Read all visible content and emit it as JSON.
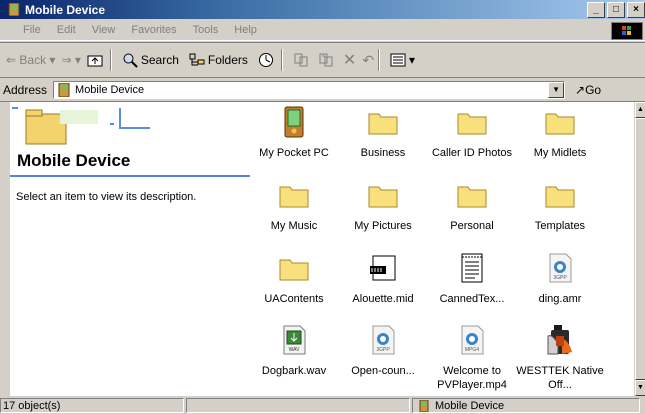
{
  "window": {
    "title": "Mobile Device",
    "icon": "mobile-device-icon"
  },
  "menu": [
    "File",
    "Edit",
    "View",
    "Favorites",
    "Tools",
    "Help"
  ],
  "toolbar": {
    "back": "Back",
    "search": "Search",
    "folders": "Folders"
  },
  "address": {
    "label": "Address",
    "value": "Mobile Device",
    "go": "Go"
  },
  "left_pane": {
    "title": "Mobile Device",
    "description": "Select an item to view its description."
  },
  "items": [
    {
      "label": "My Pocket PC",
      "icon": "pocket-pc-icon"
    },
    {
      "label": "Business",
      "icon": "folder-icon"
    },
    {
      "label": "Caller ID Photos",
      "icon": "folder-icon"
    },
    {
      "label": "My Midlets",
      "icon": "folder-icon"
    },
    {
      "label": "My Music",
      "icon": "folder-icon"
    },
    {
      "label": "My Pictures",
      "icon": "folder-icon"
    },
    {
      "label": "Personal",
      "icon": "folder-icon"
    },
    {
      "label": "Templates",
      "icon": "folder-icon"
    },
    {
      "label": "UAContents",
      "icon": "folder-icon"
    },
    {
      "label": "Alouette.mid",
      "icon": "midi-file-icon"
    },
    {
      "label": "CannedTex...",
      "icon": "text-file-icon"
    },
    {
      "label": "ding.amr",
      "icon": "3gpp-file-icon"
    },
    {
      "label": "Dogbark.wav",
      "icon": "wav-file-icon"
    },
    {
      "label": "Open-coun...",
      "icon": "3gpp-file-icon"
    },
    {
      "label": "Welcome to PVPlayer.mp4",
      "icon": "mp4-file-icon"
    },
    {
      "label": "WESTTEK Native Off...",
      "icon": "installer-icon"
    }
  ],
  "status": {
    "count": "17 object(s)",
    "location": "Mobile Device"
  }
}
